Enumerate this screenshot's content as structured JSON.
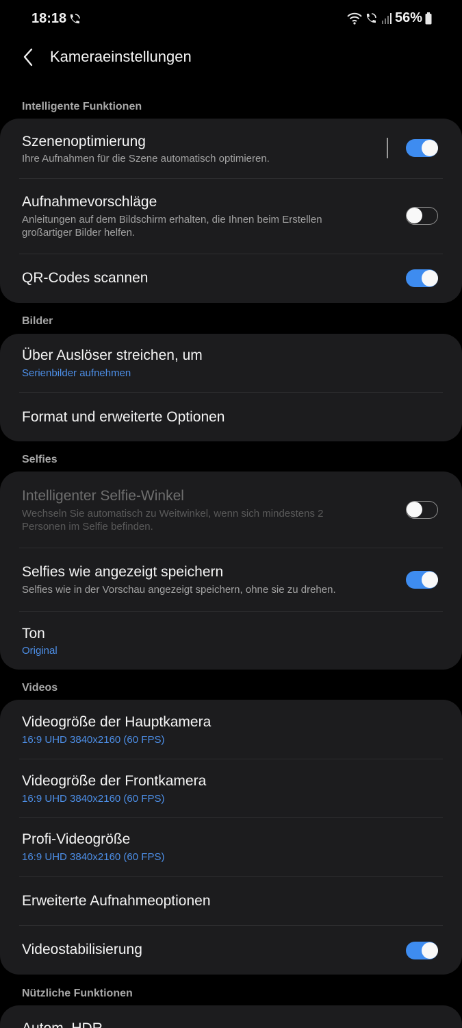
{
  "status": {
    "time": "18:18",
    "battery": "56%"
  },
  "header": {
    "title": "Kameraeinstellungen"
  },
  "sections": {
    "smart": "Intelligente Funktionen",
    "pictures": "Bilder",
    "selfies": "Selfies",
    "videos": "Videos",
    "useful": "Nützliche Funktionen"
  },
  "items": {
    "scene": {
      "title": "Szenenoptimierung",
      "sub": "Ihre Aufnahmen für die Szene automatisch optimieren.",
      "enabled": true
    },
    "shot": {
      "title": "Aufnahmevorschläge",
      "sub": "Anleitungen auf dem Bildschirm erhalten, die Ihnen beim Erstellen großartiger Bilder helfen.",
      "enabled": false
    },
    "qr": {
      "title": "QR-Codes scannen",
      "enabled": true
    },
    "swipe": {
      "title": "Über Auslöser streichen, um",
      "value": "Serienbilder aufnehmen"
    },
    "format": {
      "title": "Format und erweiterte Optionen"
    },
    "selfie_angle": {
      "title": "Intelligenter Selfie-Winkel",
      "sub": "Wechseln Sie automatisch zu Weitwinkel, wenn sich mindestens 2 Personen im Selfie befinden.",
      "enabled": false
    },
    "selfie_save": {
      "title": "Selfies wie angezeigt speichern",
      "sub": "Selfies wie in der Vorschau angezeigt speichern, ohne sie zu drehen.",
      "enabled": true
    },
    "tone": {
      "title": "Ton",
      "value": "Original"
    },
    "rear_video": {
      "title": "Videogröße der Hauptkamera",
      "value": "16:9 UHD 3840x2160 (60 FPS)"
    },
    "front_video": {
      "title": "Videogröße der Frontkamera",
      "value": "16:9 UHD 3840x2160 (60 FPS)"
    },
    "pro_video": {
      "title": "Profi-Videogröße",
      "value": "16:9 UHD 3840x2160 (60 FPS)"
    },
    "advanced": {
      "title": "Erweiterte Aufnahmeoptionen"
    },
    "stabilization": {
      "title": "Videostabilisierung",
      "enabled": true
    },
    "hdr": {
      "title": "Autom. HDR"
    }
  },
  "colors": {
    "accent": "#3e8cf0",
    "value_text": "#4d8fe8",
    "card": "#1c1c1e"
  }
}
